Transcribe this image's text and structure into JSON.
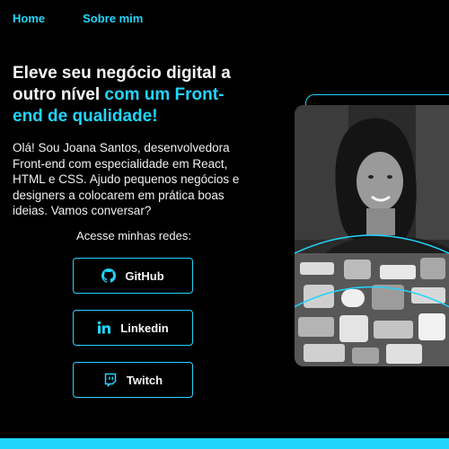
{
  "nav": {
    "home": "Home",
    "about": "Sobre mim"
  },
  "hero": {
    "title_plain": "Eleve seu negócio digital a outro nível ",
    "title_accent": "com um Front-end de qualidade!",
    "description": "Olá! Sou Joana Santos, desenvolvedora Front-end com especialidade em React, HTML e CSS. Ajudo pequenos negócios e designers a colocarem em prática boas ideias. Vamos conversar?"
  },
  "socials": {
    "label": "Acesse minhas redes:",
    "github": "GitHub",
    "linkedin": "Linkedin",
    "twitch": "Twitch"
  },
  "colors": {
    "accent": "#22d4fd",
    "background": "#000000",
    "text": "#f6f6f6"
  }
}
